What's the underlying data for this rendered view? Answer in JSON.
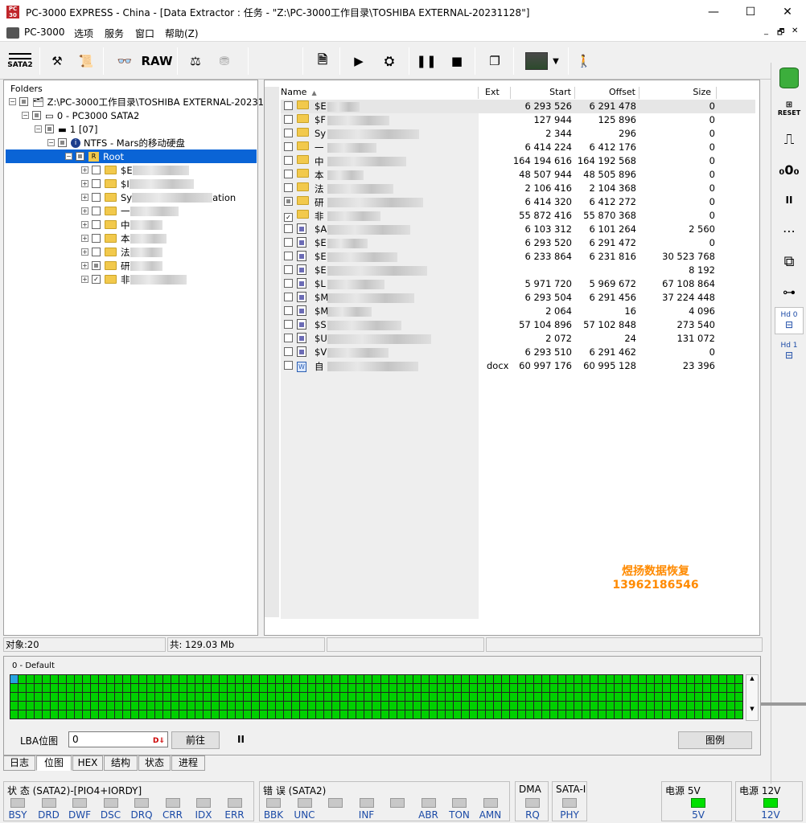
{
  "titlebar": {
    "title": "PC-3000 EXPRESS - China - [Data Extractor : 任务 - \"Z:\\PC-3000工作目录\\TOSHIBA EXTERNAL-20231128\"]",
    "minimize": "—",
    "maximize": "☐",
    "close": "✕"
  },
  "menu": {
    "app": "PC-3000",
    "options": "选项",
    "service": "服务",
    "window": "窗口",
    "help": "帮助(Z)",
    "mdi_min": "_",
    "mdi_restore": "🗗",
    "mdi_close": "✕"
  },
  "toolbar": {
    "sata2": "SATA2",
    "raw": "RAW"
  },
  "folders": {
    "header": "Folders",
    "nodes": [
      {
        "label": "Z:\\PC-3000工作目录\\TOSHIBA EXTERNAL-202311"
      },
      {
        "label": "0 - PC3000 SATA2"
      },
      {
        "label": "1 [07]"
      },
      {
        "label": "NTFS - Mars的移动硬盘"
      },
      {
        "label": "Root"
      },
      {
        "label": "$E"
      },
      {
        "label": "$I"
      },
      {
        "label": "Sy",
        "suffix": "ation"
      },
      {
        "label": "一"
      },
      {
        "label": "中"
      },
      {
        "label": "本"
      },
      {
        "label": "法"
      },
      {
        "label": "研"
      },
      {
        "label": "非"
      }
    ]
  },
  "filelist": {
    "columns": {
      "name": "Name",
      "ext": "Ext",
      "start": "Start",
      "offset": "Offset",
      "size": "Size"
    },
    "rows": [
      {
        "name": "$E",
        "ext": "",
        "start": "6 293 526",
        "offset": "6 291 478",
        "size": "0",
        "icon": "folder"
      },
      {
        "name": "$F",
        "ext": "",
        "start": "127 944",
        "offset": "125 896",
        "size": "0",
        "icon": "folder"
      },
      {
        "name": "Sy",
        "ext": "",
        "start": "2 344",
        "offset": "296",
        "size": "0",
        "icon": "folder"
      },
      {
        "name": "一",
        "ext": "",
        "start": "6 414 224",
        "offset": "6 412 176",
        "size": "0",
        "icon": "folder"
      },
      {
        "name": "中",
        "ext": "",
        "start": "164 194 616",
        "offset": "164 192 568",
        "size": "0",
        "icon": "folder"
      },
      {
        "name": "本",
        "ext": "",
        "start": "48 507 944",
        "offset": "48 505 896",
        "size": "0",
        "icon": "folder"
      },
      {
        "name": "法",
        "ext": "",
        "start": "2 106 416",
        "offset": "2 104 368",
        "size": "0",
        "icon": "folder"
      },
      {
        "name": "研",
        "ext": "",
        "start": "6 414 320",
        "offset": "6 412 272",
        "size": "0",
        "icon": "folder"
      },
      {
        "name": "非",
        "ext": "",
        "start": "55 872 416",
        "offset": "55 870 368",
        "size": "0",
        "icon": "folder"
      },
      {
        "name": "$A",
        "ext": "",
        "start": "6 103 312",
        "offset": "6 101 264",
        "size": "2 560",
        "icon": "file"
      },
      {
        "name": "$E",
        "ext": "",
        "start": "6 293 520",
        "offset": "6 291 472",
        "size": "0",
        "icon": "file"
      },
      {
        "name": "$E",
        "ext": "",
        "start": "6 233 864",
        "offset": "6 231 816",
        "size": "30 523 768",
        "icon": "file"
      },
      {
        "name": "$E",
        "ext": "",
        "start": "",
        "offset": "",
        "size": "8 192",
        "icon": "file"
      },
      {
        "name": "$L",
        "ext": "",
        "start": "5 971 720",
        "offset": "5 969 672",
        "size": "67 108 864",
        "icon": "file"
      },
      {
        "name": "$M",
        "ext": "",
        "start": "6 293 504",
        "offset": "6 291 456",
        "size": "37 224 448",
        "icon": "file"
      },
      {
        "name": "$M",
        "ext": "",
        "start": "2 064",
        "offset": "16",
        "size": "4 096",
        "icon": "file"
      },
      {
        "name": "$S",
        "ext": "",
        "start": "57 104 896",
        "offset": "57 102 848",
        "size": "273 540",
        "icon": "file"
      },
      {
        "name": "$U",
        "ext": "",
        "start": "2 072",
        "offset": "24",
        "size": "131 072",
        "icon": "file"
      },
      {
        "name": "$V",
        "ext": "",
        "start": "6 293 510",
        "offset": "6 291 462",
        "size": "0",
        "icon": "file"
      },
      {
        "name": "自",
        "ext": "docx",
        "start": "60 997 176",
        "offset": "60 995 128",
        "size": "23 396",
        "icon": "doc"
      }
    ]
  },
  "watermark": {
    "line1": "煜扬数据恢复",
    "line2": "13962186546"
  },
  "status": {
    "objects": "对象:20",
    "total": "共: 129.03 Mb"
  },
  "bitmap": {
    "label": "0 - Default",
    "lba_label": "LBA位图",
    "lba_value": "0",
    "goto": "前往",
    "pause": "II",
    "legend": "图例"
  },
  "tabs": [
    "日志",
    "位图",
    "HEX",
    "结构",
    "状态",
    "进程"
  ],
  "bottom": {
    "status_group": "状 态 (SATA2)-[PIO4+IORDY]",
    "status_leds": [
      "BSY",
      "DRD",
      "DWF",
      "DSC",
      "DRQ",
      "CRR",
      "IDX",
      "ERR"
    ],
    "error_group": "错 误 (SATA2)",
    "error_leds": [
      "BBK",
      "UNC",
      "",
      "INF",
      "",
      "ABR",
      "TON",
      "AMN"
    ],
    "dma_group": "DMA",
    "dma_leds": [
      "RQ"
    ],
    "sata_group": "SATA-I",
    "sata_leds": [
      "PHY"
    ],
    "pwr5_group": "电源 5V",
    "pwr5_label": "5V",
    "pwr12_group": "电源 12V",
    "pwr12_label": "12V"
  },
  "rightbar": {
    "reset": "RESET",
    "hd0": "Hd 0",
    "hd1": "Hd 1",
    "pause": "II"
  },
  "colors": {
    "selection": "#0a64d6",
    "led_on": "#00e000",
    "bitmap_ok": "#00d000",
    "watermark": "#ff8a00"
  }
}
